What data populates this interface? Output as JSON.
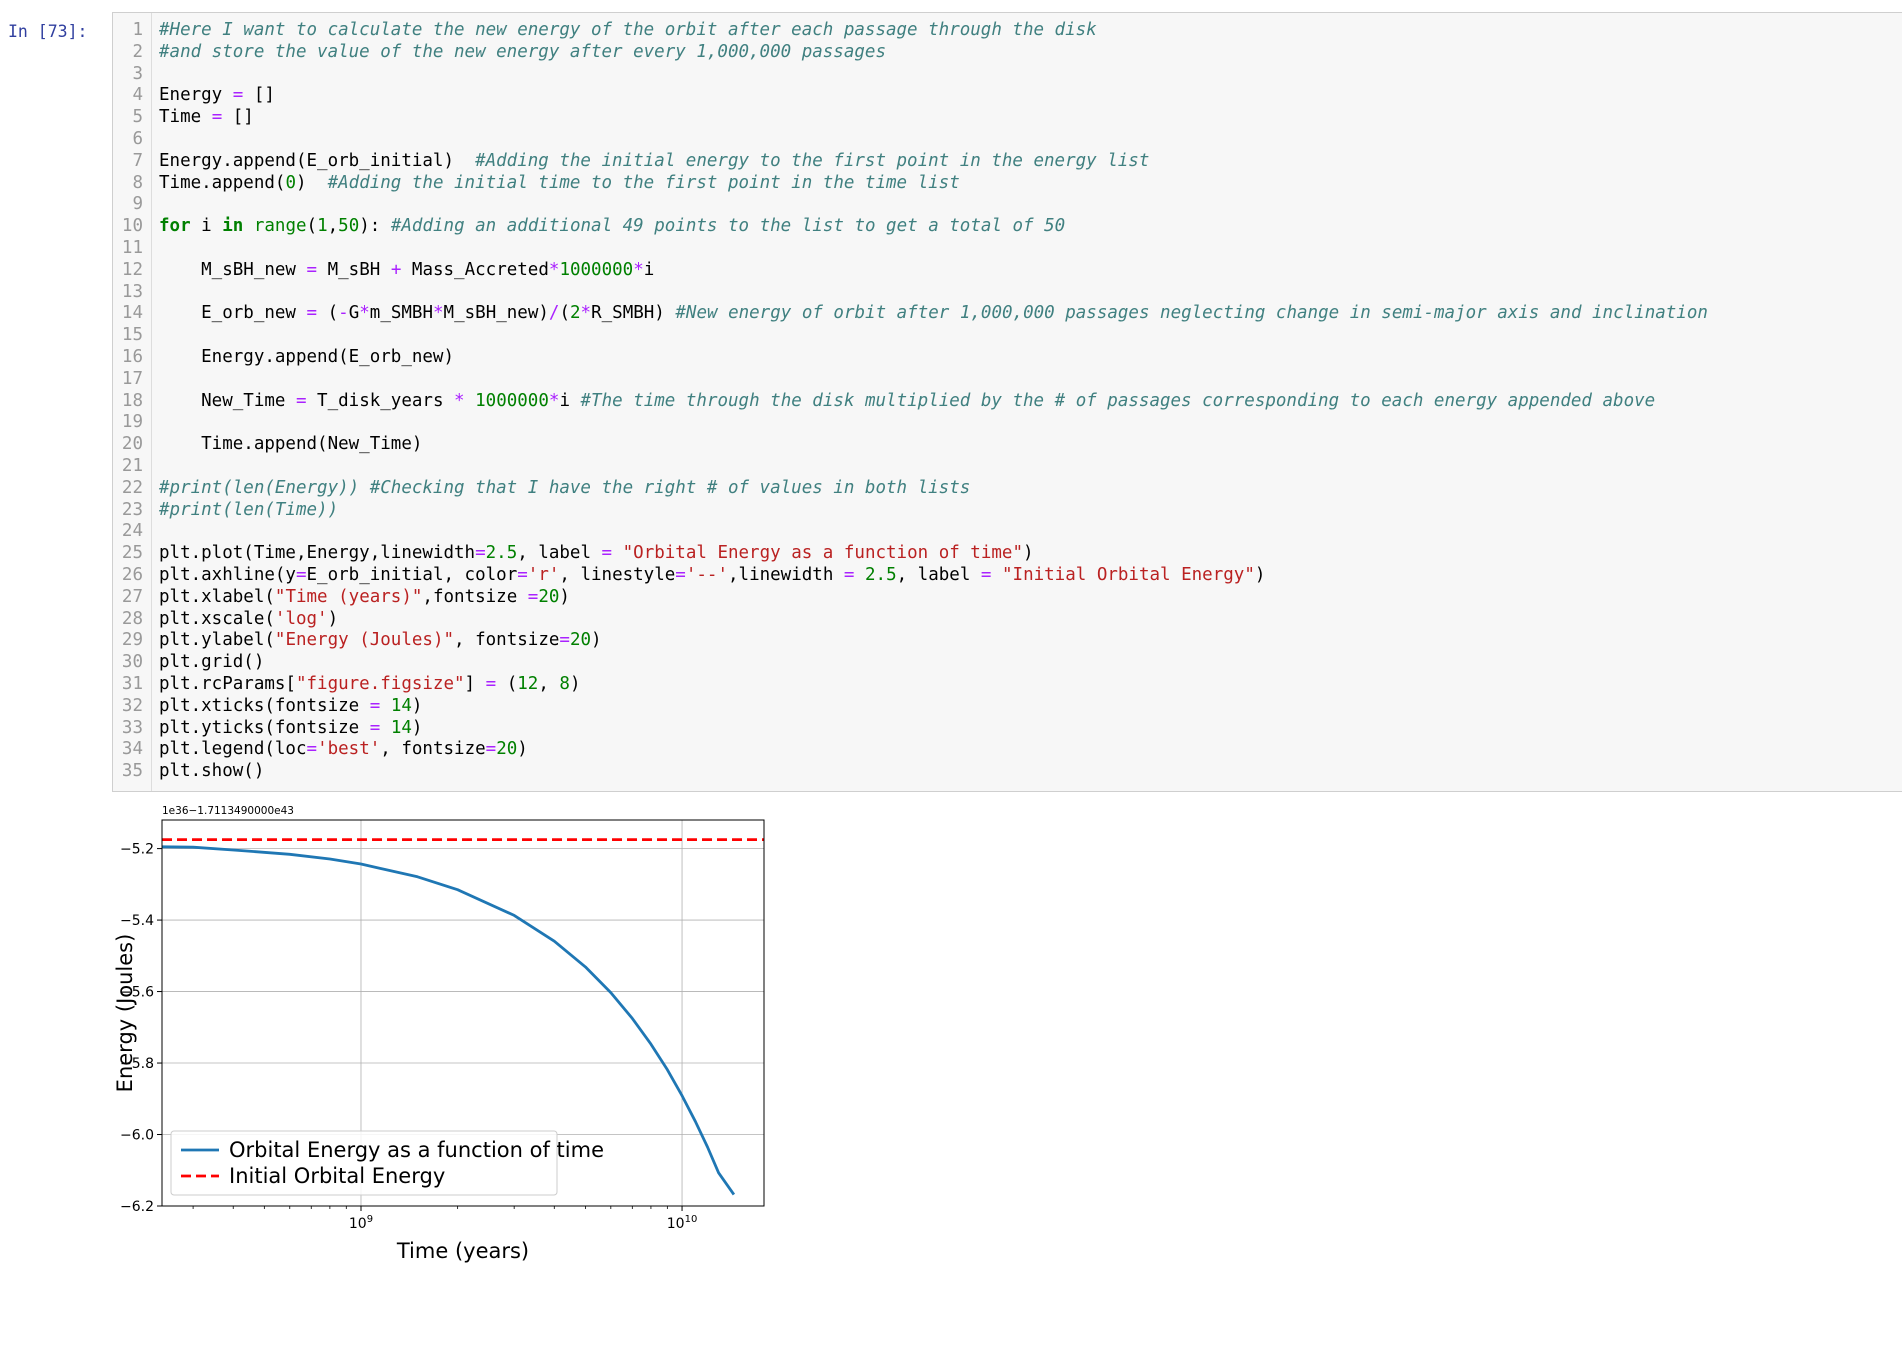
{
  "prompt": "In [73]:",
  "code_lines": [
    {
      "n": "1",
      "tokens": [
        [
          "cm",
          "#Here I want to calculate the new energy of the orbit after each passage through the disk"
        ]
      ]
    },
    {
      "n": "2",
      "tokens": [
        [
          "cm",
          "#and store the value of the new energy after every 1,000,000 passages"
        ]
      ]
    },
    {
      "n": "3",
      "tokens": []
    },
    {
      "n": "4",
      "tokens": [
        [
          "",
          "Energy "
        ],
        [
          "op",
          "="
        ],
        [
          "",
          " []"
        ]
      ]
    },
    {
      "n": "5",
      "tokens": [
        [
          "",
          "Time "
        ],
        [
          "op",
          "="
        ],
        [
          "",
          " []"
        ]
      ]
    },
    {
      "n": "6",
      "tokens": []
    },
    {
      "n": "7",
      "tokens": [
        [
          "",
          "Energy.append(E_orb_initial)  "
        ],
        [
          "cm",
          "#Adding the initial energy to the first point in the energy list"
        ]
      ]
    },
    {
      "n": "8",
      "tokens": [
        [
          "",
          "Time.append("
        ],
        [
          "num",
          "0"
        ],
        [
          "",
          ")  "
        ],
        [
          "cm",
          "#Adding the initial time to the first point in the time list"
        ]
      ]
    },
    {
      "n": "9",
      "tokens": []
    },
    {
      "n": "10",
      "tokens": [
        [
          "kw",
          "for"
        ],
        [
          "",
          " i "
        ],
        [
          "kw",
          "in"
        ],
        [
          "",
          " "
        ],
        [
          "nb",
          "range"
        ],
        [
          "",
          "("
        ],
        [
          "num",
          "1"
        ],
        [
          "",
          ","
        ],
        [
          "num",
          "50"
        ],
        [
          "",
          "): "
        ],
        [
          "cm",
          "#Adding an additional 49 points to the list to get a total of 50"
        ]
      ]
    },
    {
      "n": "11",
      "tokens": []
    },
    {
      "n": "12",
      "tokens": [
        [
          "",
          "    M_sBH_new "
        ],
        [
          "op",
          "="
        ],
        [
          "",
          " M_sBH "
        ],
        [
          "op",
          "+"
        ],
        [
          "",
          " Mass_Accreted"
        ],
        [
          "op",
          "*"
        ],
        [
          "num",
          "1000000"
        ],
        [
          "op",
          "*"
        ],
        [
          "",
          "i"
        ]
      ]
    },
    {
      "n": "13",
      "tokens": []
    },
    {
      "n": "14",
      "tokens": [
        [
          "",
          "    E_orb_new "
        ],
        [
          "op",
          "="
        ],
        [
          "",
          " ("
        ],
        [
          "op",
          "-"
        ],
        [
          "",
          "G"
        ],
        [
          "op",
          "*"
        ],
        [
          "",
          "m_SMBH"
        ],
        [
          "op",
          "*"
        ],
        [
          "",
          "M_sBH_new)"
        ],
        [
          "op",
          "/"
        ],
        [
          "",
          "("
        ],
        [
          "num",
          "2"
        ],
        [
          "op",
          "*"
        ],
        [
          "",
          "R_SMBH) "
        ],
        [
          "cm",
          "#New energy of orbit after 1,000,000 passages neglecting change in semi-major axis and inclination"
        ]
      ]
    },
    {
      "n": "15",
      "tokens": []
    },
    {
      "n": "16",
      "tokens": [
        [
          "",
          "    Energy.append(E_orb_new)"
        ]
      ]
    },
    {
      "n": "17",
      "tokens": []
    },
    {
      "n": "18",
      "tokens": [
        [
          "",
          "    New_Time "
        ],
        [
          "op",
          "="
        ],
        [
          "",
          " T_disk_years "
        ],
        [
          "op",
          "*"
        ],
        [
          "",
          " "
        ],
        [
          "num",
          "1000000"
        ],
        [
          "op",
          "*"
        ],
        [
          "",
          "i "
        ],
        [
          "cm",
          "#The time through the disk multiplied by the # of passages corresponding to each energy appended above"
        ]
      ]
    },
    {
      "n": "19",
      "tokens": []
    },
    {
      "n": "20",
      "tokens": [
        [
          "",
          "    Time.append(New_Time)"
        ]
      ]
    },
    {
      "n": "21",
      "tokens": []
    },
    {
      "n": "22",
      "tokens": [
        [
          "cm",
          "#print(len(Energy)) #Checking that I have the right # of values in both lists"
        ]
      ]
    },
    {
      "n": "23",
      "tokens": [
        [
          "cm",
          "#print(len(Time))"
        ]
      ]
    },
    {
      "n": "24",
      "tokens": []
    },
    {
      "n": "25",
      "tokens": [
        [
          "",
          "plt.plot(Time,Energy,linewidth"
        ],
        [
          "op",
          "="
        ],
        [
          "num",
          "2.5"
        ],
        [
          "",
          ", label "
        ],
        [
          "op",
          "="
        ],
        [
          "",
          " "
        ],
        [
          "str",
          "\"Orbital Energy as a function of time\""
        ],
        [
          "",
          ")"
        ]
      ]
    },
    {
      "n": "26",
      "tokens": [
        [
          "",
          "plt.axhline(y"
        ],
        [
          "op",
          "="
        ],
        [
          "",
          "E_orb_initial, color"
        ],
        [
          "op",
          "="
        ],
        [
          "str",
          "'r'"
        ],
        [
          "",
          ", linestyle"
        ],
        [
          "op",
          "="
        ],
        [
          "str",
          "'--'"
        ],
        [
          "",
          ",linewidth "
        ],
        [
          "op",
          "="
        ],
        [
          "",
          " "
        ],
        [
          "num",
          "2.5"
        ],
        [
          "",
          ", label "
        ],
        [
          "op",
          "="
        ],
        [
          "",
          " "
        ],
        [
          "str",
          "\"Initial Orbital Energy\""
        ],
        [
          "",
          ")"
        ]
      ]
    },
    {
      "n": "27",
      "tokens": [
        [
          "",
          "plt.xlabel("
        ],
        [
          "str",
          "\"Time (years)\""
        ],
        [
          "",
          ",fontsize "
        ],
        [
          "op",
          "="
        ],
        [
          "num",
          "20"
        ],
        [
          "",
          ")"
        ]
      ]
    },
    {
      "n": "28",
      "tokens": [
        [
          "",
          "plt.xscale("
        ],
        [
          "str",
          "'log'"
        ],
        [
          "",
          ")"
        ]
      ]
    },
    {
      "n": "29",
      "tokens": [
        [
          "",
          "plt.ylabel("
        ],
        [
          "str",
          "\"Energy (Joules)\""
        ],
        [
          "",
          ", fontsize"
        ],
        [
          "op",
          "="
        ],
        [
          "num",
          "20"
        ],
        [
          "",
          ")"
        ]
      ]
    },
    {
      "n": "30",
      "tokens": [
        [
          "",
          "plt.grid()"
        ]
      ]
    },
    {
      "n": "31",
      "tokens": [
        [
          "",
          "plt.rcParams["
        ],
        [
          "str",
          "\"figure.figsize\""
        ],
        [
          "",
          "] "
        ],
        [
          "op",
          "="
        ],
        [
          "",
          " ("
        ],
        [
          "num",
          "12"
        ],
        [
          "",
          ", "
        ],
        [
          "num",
          "8"
        ],
        [
          "",
          ")"
        ]
      ]
    },
    {
      "n": "32",
      "tokens": [
        [
          "",
          "plt.xticks(fontsize "
        ],
        [
          "op",
          "="
        ],
        [
          "",
          " "
        ],
        [
          "num",
          "14"
        ],
        [
          "",
          ")"
        ]
      ]
    },
    {
      "n": "33",
      "tokens": [
        [
          "",
          "plt.yticks(fontsize "
        ],
        [
          "op",
          "="
        ],
        [
          "",
          " "
        ],
        [
          "num",
          "14"
        ],
        [
          "",
          ")"
        ]
      ]
    },
    {
      "n": "34",
      "tokens": [
        [
          "",
          "plt.legend(loc"
        ],
        [
          "op",
          "="
        ],
        [
          "str",
          "'best'"
        ],
        [
          "",
          ", fontsize"
        ],
        [
          "op",
          "="
        ],
        [
          "num",
          "20"
        ],
        [
          "",
          ")"
        ]
      ]
    },
    {
      "n": "35",
      "tokens": [
        [
          "",
          "plt.show()"
        ]
      ]
    }
  ],
  "chart_data": {
    "type": "line",
    "xscale": "log",
    "xlabel": "Time (years)",
    "ylabel": "Energy (Joules)",
    "offset_text": "1e36−1.7113490000e43",
    "xlim": [
      240000000,
      18000000000
    ],
    "ylim": [
      -6.2,
      -5.12
    ],
    "x_ticks": [
      {
        "value": 1000000000,
        "base": "10",
        "exp": "9"
      },
      {
        "value": 10000000000,
        "base": "10",
        "exp": "10"
      }
    ],
    "y_ticks": [
      {
        "value": -5.2,
        "label": "−5.2"
      },
      {
        "value": -5.4,
        "label": "−5.4"
      },
      {
        "value": -5.6,
        "label": "−5.6"
      },
      {
        "value": -5.8,
        "label": "−5.8"
      },
      {
        "value": -6.0,
        "label": "−6.0"
      },
      {
        "value": -6.2,
        "label": "−6.2"
      }
    ],
    "grid": true,
    "legend_loc": "lower-left",
    "series": [
      {
        "name": "Orbital Energy as a function of time",
        "color": "#1f77b4",
        "style": "solid",
        "x": [
          240000000,
          300000000,
          400000000,
          600000000,
          800000000,
          1000000000,
          1500000000,
          2000000000,
          3000000000,
          4000000000,
          5000000000,
          6000000000,
          7000000000,
          8000000000,
          9000000000,
          10000000000,
          11000000000,
          12000000000,
          13000000000,
          14500000000
        ],
        "y": [
          -5.195,
          -5.196,
          -5.204,
          -5.216,
          -5.229,
          -5.243,
          -5.279,
          -5.315,
          -5.387,
          -5.459,
          -5.531,
          -5.603,
          -5.675,
          -5.747,
          -5.819,
          -5.891,
          -5.963,
          -6.035,
          -6.107,
          -6.168
        ]
      },
      {
        "name": "Initial Orbital Energy",
        "color": "#ff0000",
        "style": "dashed",
        "hline": -5.175
      }
    ]
  }
}
